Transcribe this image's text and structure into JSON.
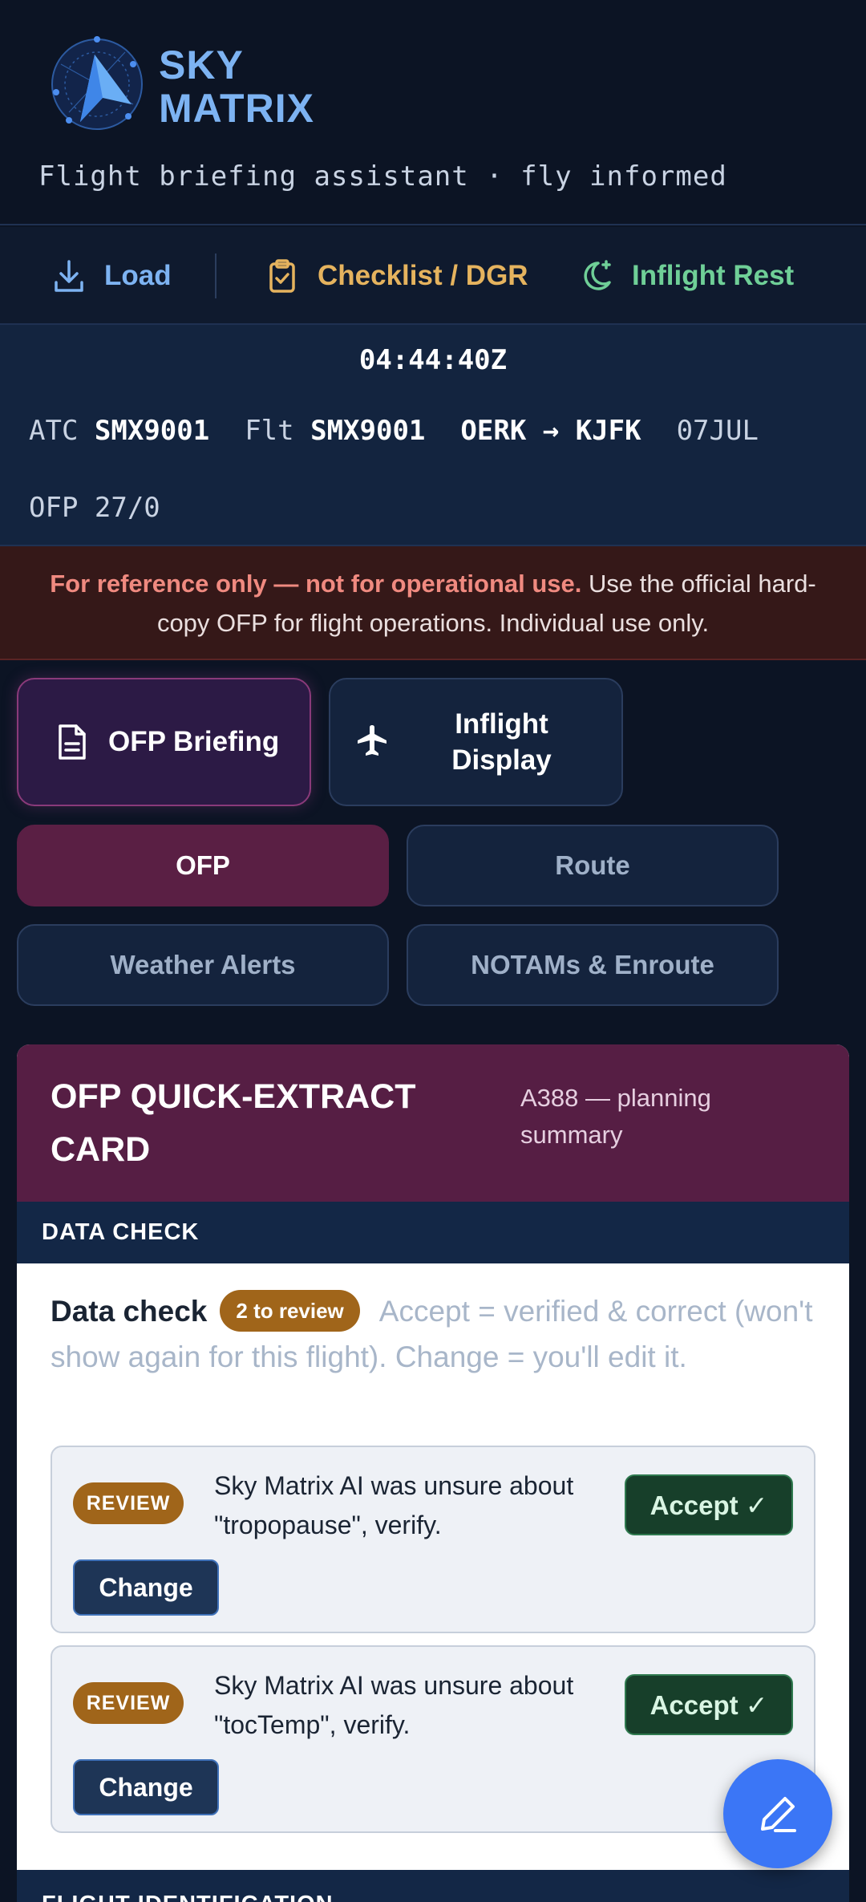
{
  "app": {
    "brand_line1": "SKY",
    "brand_line2": "MATRIX",
    "tagline": "Flight briefing assistant · fly informed"
  },
  "toolbar": {
    "load": "Load",
    "checklist": "Checklist / DGR",
    "rest": "Inflight Rest"
  },
  "flight": {
    "clock": "04:44:40Z",
    "atc_label": "ATC",
    "atc_value": "SMX9001",
    "flt_label": "Flt",
    "flt_value": "SMX9001",
    "route": "OERK → KJFK",
    "date": "07JUL",
    "ofp": "OFP 27/0"
  },
  "disclaimer": {
    "warning": "For reference only — not for operational use.",
    "text": " Use the official hard-copy OFP for flight operations. Individual use only."
  },
  "modes": {
    "ofp_briefing": "OFP Briefing",
    "inflight_line1": "Inflight",
    "inflight_line2": "Display"
  },
  "tabs": {
    "ofp": "OFP",
    "route": "Route",
    "weather": "Weather Alerts",
    "notams": "NOTAMs & Enroute"
  },
  "card": {
    "title": "OFP QUICK-EXTRACT CARD",
    "subtitle": "A388 — planning summary",
    "section_data_check": "DATA CHECK",
    "data_check_title": "Data check",
    "review_count": "2 to review",
    "data_check_help": "Accept = verified & correct (won't show again for this flight). Change = you'll edit it.",
    "items": [
      {
        "tag": "REVIEW",
        "message": "Sky Matrix AI was unsure about \"tropopause\", verify.",
        "accept": "Accept ✓",
        "change": "Change"
      },
      {
        "tag": "REVIEW",
        "message": "Sky Matrix AI was unsure about \"tocTemp\", verify.",
        "accept": "Accept ✓",
        "change": "Change"
      }
    ],
    "section_flight_id": "FLIGHT IDENTIFICATION"
  },
  "colors": {
    "accent": "#3b76f6",
    "active_tab": "#5a1f44",
    "review_badge": "#a0651a",
    "accept": "#173f2a"
  },
  "icons": {
    "load": "download-icon",
    "checklist": "clipboard-check-icon",
    "rest": "moon-sparkle-icon",
    "ofp_briefing": "document-icon",
    "inflight": "airplane-icon",
    "fab": "pencil-icon"
  }
}
